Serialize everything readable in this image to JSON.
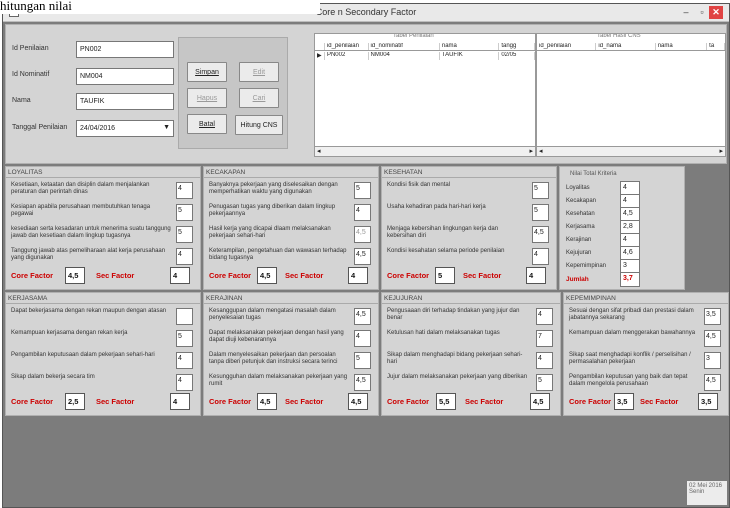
{
  "caption": "hitungan nilai",
  "window": {
    "title": "Core n Secondary Factor",
    "minimize": "–",
    "maximize": "▫",
    "close": "✕"
  },
  "form": {
    "id_penilaian": {
      "label": "Id Penilaian",
      "value": "PN002"
    },
    "id_nominatif": {
      "label": "Id Nominatif",
      "value": "NM004"
    },
    "nama": {
      "label": "Nama",
      "value": "TAUFIK"
    },
    "tanggal": {
      "label": "Tanggal Penilaian",
      "value": "24/04/2016"
    }
  },
  "buttons": {
    "simpan": "Simpan",
    "edit": "Edit",
    "hapus": "Hapus",
    "cari": "Cari",
    "batal": "Batal",
    "hitung": "Hitung CNS"
  },
  "tabel_penilaian": {
    "title": "Tabel Penilaian",
    "columns": [
      "id_penilaian",
      "id_nominatif",
      "nama",
      "tangg"
    ],
    "rows": [
      [
        "PN002",
        "NM004",
        "TAUFIK",
        "02/05"
      ]
    ]
  },
  "tabel_hasil": {
    "title": "Tabel Hasil CNS",
    "columns": [
      "id_penilaian",
      "id_nama",
      "nama",
      "ta"
    ]
  },
  "groups": [
    {
      "title": "LOYALITAS",
      "core_label": "Core Factor",
      "core": "4,5",
      "sec_label": "Sec Factor",
      "sec": "4",
      "items": [
        {
          "label": "Kesetiaan, ketaatan dan disiplin dalam menjalankan peraturan dan perintah dinas",
          "value": "4"
        },
        {
          "label": "Kesiapan apabila perusahaan membutuhkan tenaga pegawai",
          "value": "5"
        },
        {
          "label": "kesediaan serta kesadaran untuk menerima suatu tanggung jawab dan kesetiaan dalam lingkup tugasnya",
          "value": "5"
        },
        {
          "label": "Tanggung jawab atas pemeliharaan alat kerja perusahaan yang digunakan",
          "value": "4"
        }
      ]
    },
    {
      "title": "KECAKAPAN",
      "core_label": "Core Factor",
      "core": "4,5",
      "sec_label": "Sec Factor",
      "sec": "4",
      "items": [
        {
          "label": "Banyaknya pekerjaan yang diselesaikan dengan memperhatikan waktu yang digunakan",
          "value": "5"
        },
        {
          "label": "Penugasan tugas yang diberikan dalam lingkup pekerjaannya",
          "value": "4"
        },
        {
          "label": "Hasil kerja yang dicapai dlaam melaksanakan pekerjaan sehari-hari",
          "value": "4,5"
        },
        {
          "label": "Keterampilan, pengetahuan dan wawasan terhadap bidang tugasnya",
          "value": "4,5"
        }
      ]
    },
    {
      "title": "KESEHATAN",
      "core_label": "Core Factor",
      "core": "5",
      "sec_label": "Sec Factor",
      "sec": "4",
      "items": [
        {
          "label": "Kondisi fisik dan mental",
          "value": "5"
        },
        {
          "label": "Usaha kehadiran pada hari-hari kerja",
          "value": "5"
        },
        {
          "label": "Menjaga kebersihan lingkungan kerja dan kebersihan diri",
          "value": "4,5"
        },
        {
          "label": "Kondisi kesahatan selama periode penilaian",
          "value": "4"
        }
      ]
    },
    {
      "title": "KERJASAMA",
      "core_label": "Core Factor",
      "core": "2,5",
      "sec_label": "Sec Factor",
      "sec": "4",
      "items": [
        {
          "label": "Dapat bekerjasama dengan rekan maupun dengan atasan",
          "value": ""
        },
        {
          "label": "Kemampuan kerjasama dengan rekan kerja",
          "value": "5"
        },
        {
          "label": "Pengambilan keputusaan dalam pekerjaan sehari-hari",
          "value": "4"
        },
        {
          "label": "Sikap dalam bekerja secara tim",
          "value": "4"
        }
      ]
    },
    {
      "title": "KERAJINAN",
      "core_label": "Core Factor",
      "core": "4,5",
      "sec_label": "Sec Factor",
      "sec": "4,5",
      "items": [
        {
          "label": "Kesanggupan dalam mengatasi masalah dalam penyelesaian tugas",
          "value": "4,5"
        },
        {
          "label": "Dapat melaksanakan pekerjaan dengan hasil yang dapat diuji kebenarannya",
          "value": "4"
        },
        {
          "label": "Dalam menyelesaikan pekerjaan dan persoalan tanpa diberi petunjuk dan instruksi secara terinci",
          "value": "5"
        },
        {
          "label": "Kesungguhan dalam melaksanakan pekerjaan yang rumit",
          "value": "4,5"
        }
      ]
    },
    {
      "title": "KEJUJURAN",
      "core_label": "Core Factor",
      "core": "5,5",
      "sec_label": "Sec Factor",
      "sec": "4,5",
      "items": [
        {
          "label": "Pengusaaan diri terhadap tindakan yang jujur dan benar",
          "value": "4"
        },
        {
          "label": "Ketulusan hati dalam melaksanakan tugas",
          "value": "7"
        },
        {
          "label": "Sikap dalam menghadapi bidang pekerjaan sehari-hari",
          "value": "4"
        },
        {
          "label": "Jujur dalam melaksanakan pekerjaan yang diberikan",
          "value": "5"
        }
      ]
    },
    {
      "title": "KEPEMIMPINAN",
      "core_label": "Core Factor",
      "core": "3,5",
      "sec_label": "Sec Factor",
      "sec": "3,5",
      "items": [
        {
          "label": "Sesuai dengan sifat pribadi dan prestasi dalam jabatannya sekarang",
          "value": "3,5"
        },
        {
          "label": "Kemampuan dalam menggerakan bawahannya",
          "value": "4,5"
        },
        {
          "label": "Sikap saat menghadapi konflik / perselisihan / permasalahan pekerjaan",
          "value": "3"
        },
        {
          "label": "Pengambilan keputusan yang baik dan tepat dalam mengelola perusahaan",
          "value": "4,5"
        }
      ]
    }
  ],
  "totals": {
    "title": "Nilai Total Kriteria",
    "rows": [
      {
        "label": "Loyalitas",
        "value": "4"
      },
      {
        "label": "Kecakapan",
        "value": "4"
      },
      {
        "label": "Kesehatan",
        "value": "4,5"
      },
      {
        "label": "Kerjasama",
        "value": "2,8"
      },
      {
        "label": "Kerajinan",
        "value": "4"
      },
      {
        "label": "Kejujuran",
        "value": "4,6"
      },
      {
        "label": "Kepemimpinan",
        "value": "3"
      }
    ],
    "jumlah_label": "Jumlah",
    "jumlah_value": "3,7"
  },
  "status": {
    "date": "02 Mei 2016",
    "day": "Senin"
  },
  "colors": {
    "window_bg": "#7c7c7c",
    "panel_bg": "#d4d4d4",
    "factor_label": "#cc0000",
    "close_button": "#e04343"
  }
}
